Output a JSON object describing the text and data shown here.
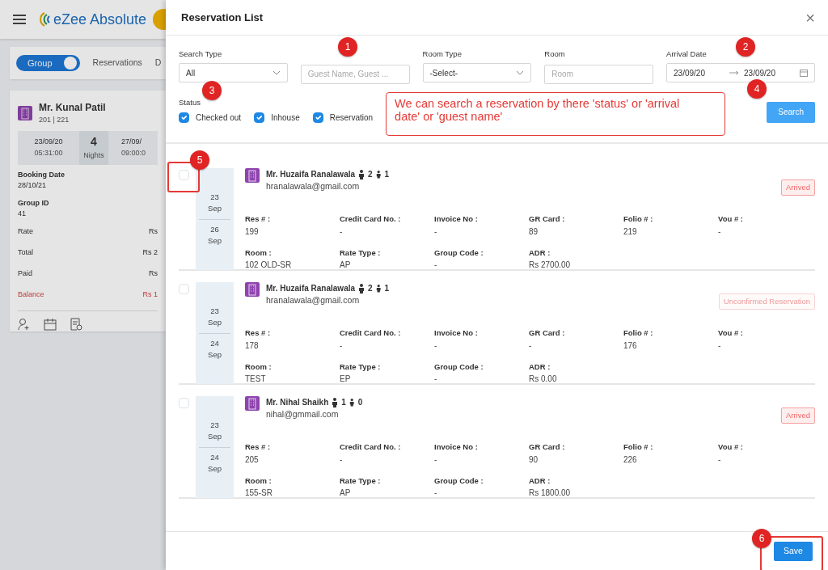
{
  "app": {
    "title": "eZee Absolute"
  },
  "background": {
    "toggle": {
      "label": "Group",
      "on": true
    },
    "tabs": [
      "Reservations",
      "D"
    ],
    "card": {
      "name": "Mr. Kunal Patil",
      "rooms": "201 | 221",
      "arrival_date": "23/09/20",
      "arrival_time": "05:31:00",
      "nights": "4",
      "nights_label": "Nights",
      "departure_date": "27/09/",
      "departure_time": "09:00:0",
      "fields": [
        {
          "label": "Booking Date",
          "value": "28/10/21"
        },
        {
          "label": "Group ID",
          "value": "41"
        }
      ],
      "amounts": [
        {
          "label": "Rate",
          "value": "Rs",
          "kind": "normal"
        },
        {
          "label": "Total",
          "value": "Rs 2",
          "kind": "normal"
        },
        {
          "label": "Paid",
          "value": "Rs",
          "kind": "normal"
        },
        {
          "label": "Balance",
          "value": "Rs 1",
          "kind": "due"
        }
      ]
    }
  },
  "modal": {
    "title": "Reservation List",
    "close": "×",
    "filters": [
      {
        "kind": "select",
        "label": "Search Type",
        "value": "All"
      },
      {
        "kind": "text",
        "placeholder": "Guest Name, Guest ...",
        "marker": "1"
      },
      {
        "kind": "select",
        "label": "Room Type",
        "value": "-Select-"
      },
      {
        "kind": "text",
        "label": "Room",
        "placeholder": "Room"
      },
      {
        "kind": "daterange",
        "label": "Arrival Date",
        "from": "23/09/20",
        "to": "23/09/20",
        "marker": "2"
      }
    ],
    "status": {
      "label": "Status",
      "marker": "3",
      "options": [
        {
          "label": "Checked out",
          "checked": true
        },
        {
          "label": "Inhouse",
          "checked": true
        },
        {
          "label": "Reservation",
          "checked": true
        }
      ]
    },
    "search_button": {
      "label": "Search",
      "marker": "4"
    },
    "reservations": [
      {
        "checked": false,
        "marker": "5",
        "from_day": "23",
        "from_month": "Sep",
        "to_day": "26",
        "to_month": "Sep",
        "name": "Mr. Huzaifa Ranalawala",
        "adults": "2",
        "children": "1",
        "email": "hranalawala@gmail.com",
        "status": {
          "label": "Arrived",
          "kind": "arrived"
        },
        "fields": [
          {
            "label": "Res # :",
            "value": "199"
          },
          {
            "label": "Credit Card No. :",
            "value": "-"
          },
          {
            "label": "Invoice No :",
            "value": "-"
          },
          {
            "label": "GR Card :",
            "value": "89"
          },
          {
            "label": "Folio # :",
            "value": "219"
          },
          {
            "label": "Vou # :",
            "value": "-"
          },
          {
            "label": "Room :",
            "value": "102 OLD-SR"
          },
          {
            "label": "Rate Type :",
            "value": "AP"
          },
          {
            "label": "Group Code :",
            "value": "-"
          },
          {
            "label": "ADR :",
            "value": "Rs 2700.00"
          }
        ]
      },
      {
        "checked": false,
        "from_day": "23",
        "from_month": "Sep",
        "to_day": "24",
        "to_month": "Sep",
        "name": "Mr. Huzaifa Ranalawala",
        "adults": "2",
        "children": "1",
        "email": "hranalawala@gmail.com",
        "status": {
          "label": "Unconfirmed Reservation",
          "kind": "unconfirmed"
        },
        "fields": [
          {
            "label": "Res # :",
            "value": "178"
          },
          {
            "label": "Credit Card No. :",
            "value": "-"
          },
          {
            "label": "Invoice No :",
            "value": "-"
          },
          {
            "label": "GR Card :",
            "value": "-"
          },
          {
            "label": "Folio # :",
            "value": "176"
          },
          {
            "label": "Vou # :",
            "value": "-"
          },
          {
            "label": "Room :",
            "value": "TEST"
          },
          {
            "label": "Rate Type :",
            "value": "EP"
          },
          {
            "label": "Group Code :",
            "value": "-"
          },
          {
            "label": "ADR :",
            "value": "Rs 0.00"
          }
        ]
      },
      {
        "checked": false,
        "from_day": "23",
        "from_month": "Sep",
        "to_day": "24",
        "to_month": "Sep",
        "name": "Mr. Nihal Shaikh",
        "adults": "1",
        "children": "0",
        "email": "nihal@gmmail.com",
        "status": {
          "label": "Arrived",
          "kind": "arrived"
        },
        "fields": [
          {
            "label": "Res # :",
            "value": "205"
          },
          {
            "label": "Credit Card No. :",
            "value": "-"
          },
          {
            "label": "Invoice No :",
            "value": "-"
          },
          {
            "label": "GR Card :",
            "value": "90"
          },
          {
            "label": "Folio # :",
            "value": "226"
          },
          {
            "label": "Vou # :",
            "value": "-"
          },
          {
            "label": "Room :",
            "value": "155-SR"
          },
          {
            "label": "Rate Type :",
            "value": "AP"
          },
          {
            "label": "Group Code :",
            "value": "-"
          },
          {
            "label": "ADR :",
            "value": "Rs 1800.00"
          }
        ]
      }
    ],
    "save_button": {
      "label": "Save",
      "marker": "6"
    }
  },
  "annotations": {
    "note": "We can search a reservation by there 'status' or 'arrival date' or 'guest name'"
  }
}
